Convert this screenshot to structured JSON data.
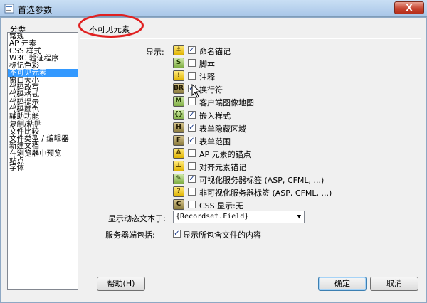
{
  "window": {
    "title": "首选参数",
    "close_glyph": "X"
  },
  "categories": {
    "label": "分类",
    "items": [
      "常规",
      "AP 元素",
      "CSS 样式",
      "W3C 验证程序",
      "标记色彩",
      "不可见元素",
      "窗口大小",
      "代码改写",
      "代码格式",
      "代码提示",
      "代码颜色",
      "辅助功能",
      "复制/粘贴",
      "文件比较",
      "文件类型 / 编辑器",
      "新建文档",
      "在浏览器中预览",
      "站点",
      "字体"
    ],
    "selected_index": 5
  },
  "panel": {
    "title": "不可见元素",
    "show_label": "显示:",
    "options": [
      {
        "label": "命名锚记",
        "checked": true,
        "icon": "anchor-icon",
        "glyph": "⚓"
      },
      {
        "label": "脚本",
        "checked": false,
        "icon": "script-icon",
        "glyph": "S"
      },
      {
        "label": "注释",
        "checked": false,
        "icon": "comment-icon",
        "glyph": "!"
      },
      {
        "label": "换行符",
        "checked": true,
        "icon": "line-break-icon",
        "glyph": "BR"
      },
      {
        "label": "客户端图像地图",
        "checked": false,
        "icon": "image-map-icon",
        "glyph": "M"
      },
      {
        "label": "嵌入样式",
        "checked": true,
        "icon": "embedded-style-icon",
        "glyph": "{}"
      },
      {
        "label": "表单隐藏区域",
        "checked": true,
        "icon": "hidden-field-icon",
        "glyph": "H"
      },
      {
        "label": "表单范围",
        "checked": true,
        "icon": "form-icon",
        "glyph": "F"
      },
      {
        "label": "AP 元素的锚点",
        "checked": false,
        "icon": "ap-anchor-icon",
        "glyph": "A"
      },
      {
        "label": "对齐元素锚记",
        "checked": false,
        "icon": "align-anchor-icon",
        "glyph": "⊥"
      },
      {
        "label": "可视化服务器标签 (ASP, CFML, ...)",
        "checked": true,
        "icon": "visual-server-tag-icon",
        "glyph": "✎"
      },
      {
        "label": "非可视化服务器标签 (ASP, CFML, ...)",
        "checked": false,
        "icon": "nonvisual-server-tag-icon",
        "glyph": "?"
      },
      {
        "label": "CSS 显示:无",
        "checked": false,
        "icon": "css-display-none-icon",
        "glyph": "C"
      }
    ],
    "dynamic_text_label": "显示动态文本于:",
    "dynamic_text_value": "{Recordset.Field}",
    "server_include_label": "服务器端包括:",
    "server_include_checked": true,
    "server_include_text": "显示所包含文件的内容"
  },
  "buttons": {
    "help": "帮助(H)",
    "ok": "确定",
    "cancel": "取消"
  },
  "colors": {
    "selection": "#3399ff",
    "annotation": "#e02020"
  }
}
